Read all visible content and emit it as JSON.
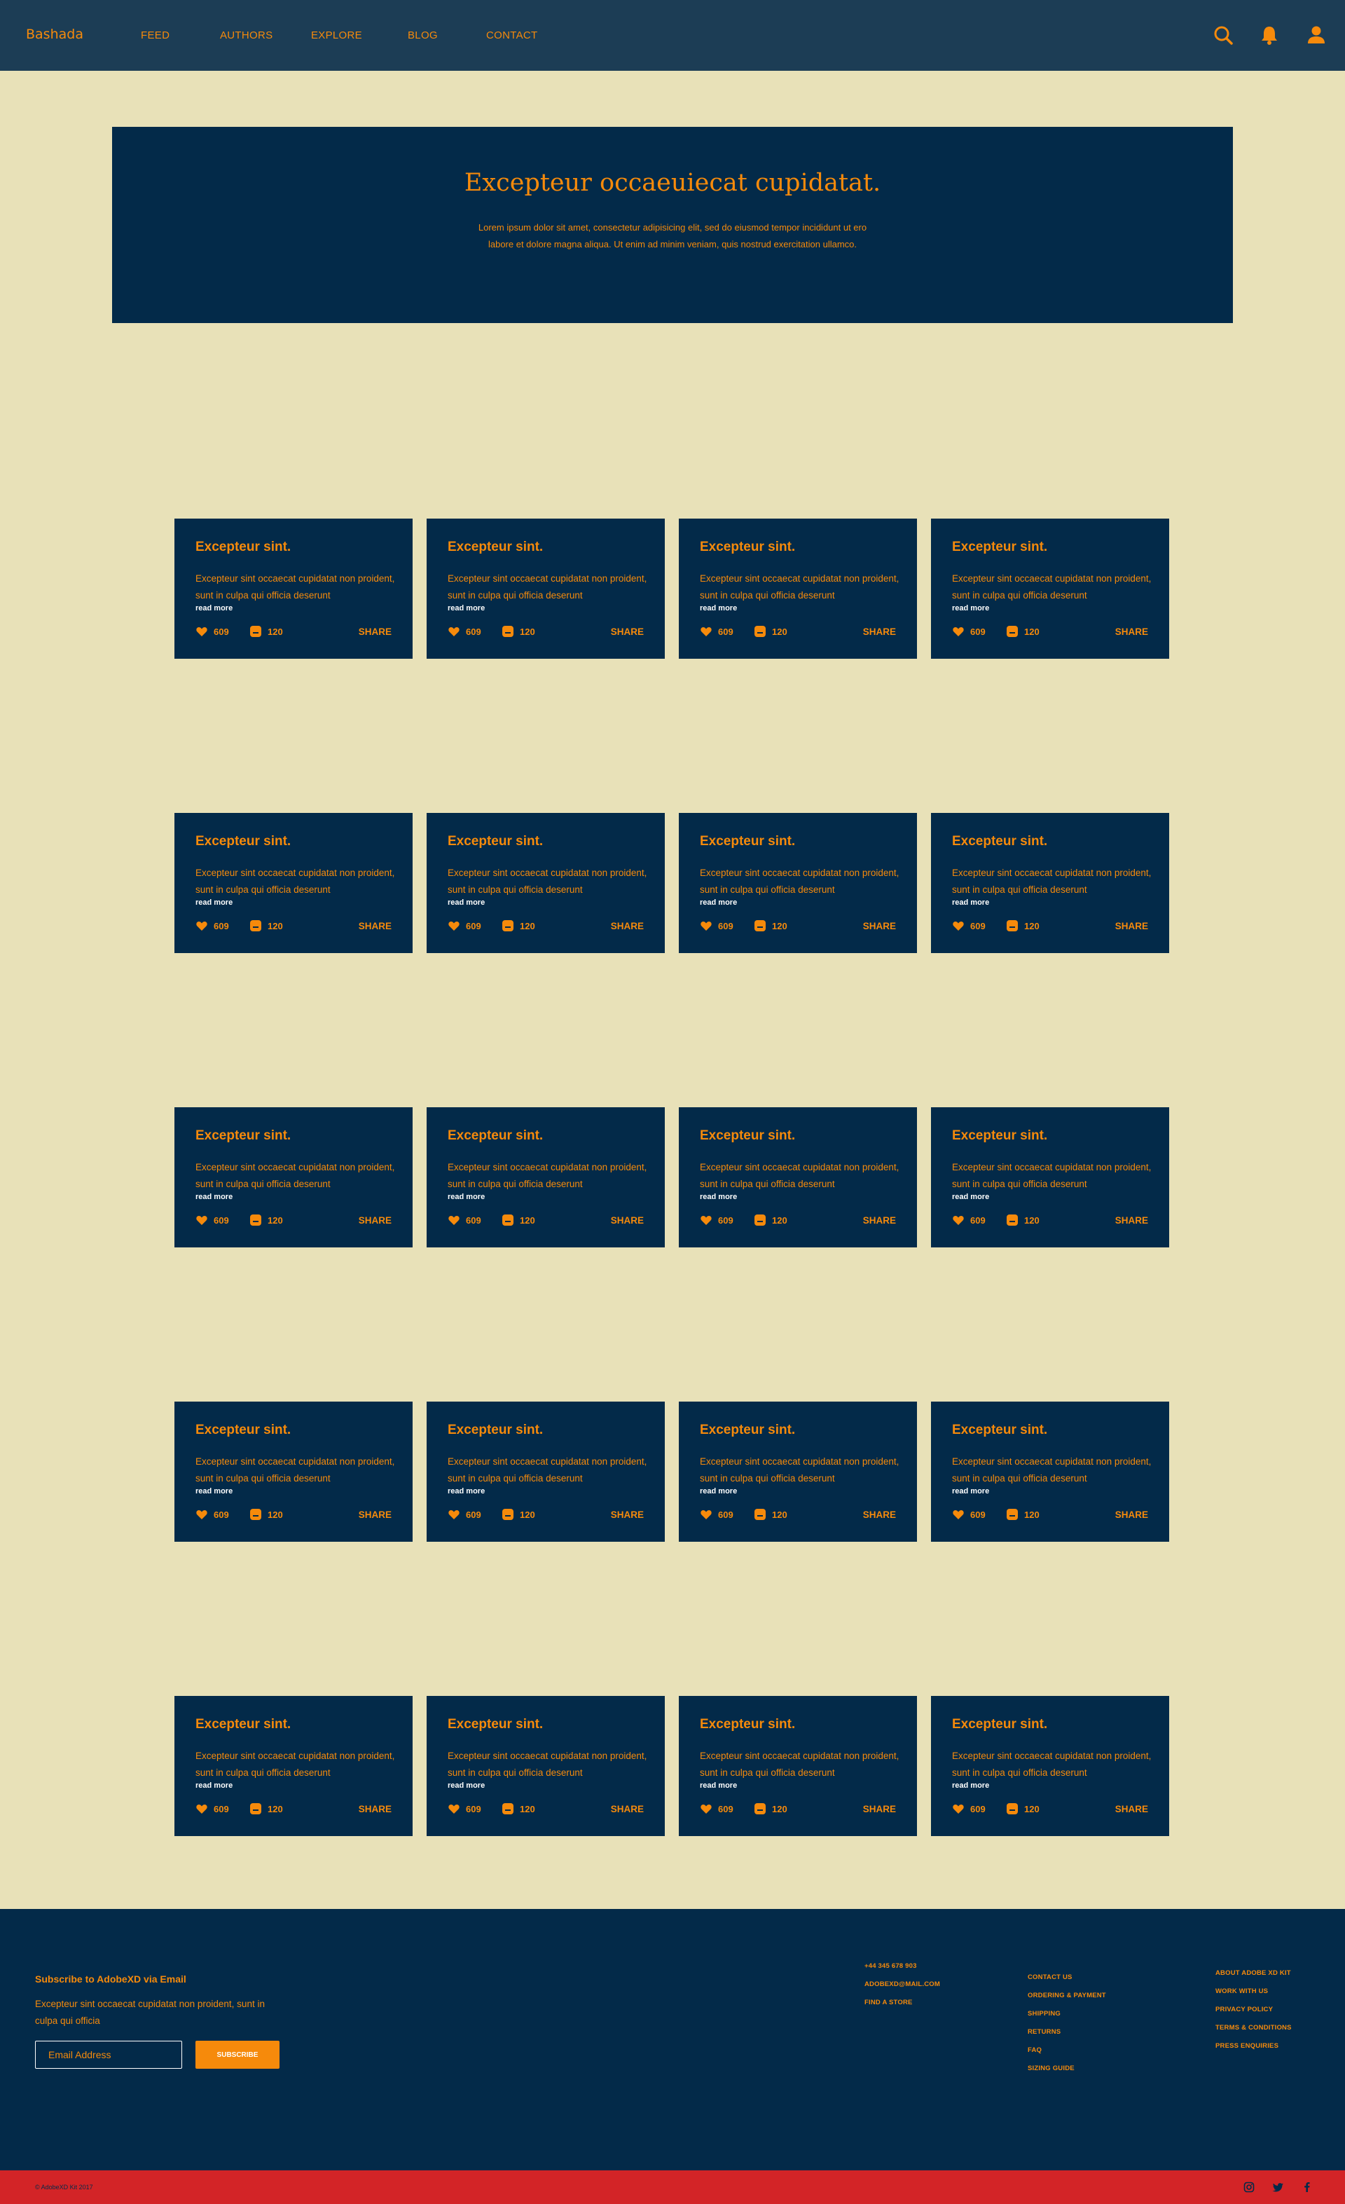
{
  "nav": {
    "brand": "Bashada",
    "links": [
      "FEED",
      "AUTHORS",
      "EXPLORE",
      "BLOG",
      "CONTACT"
    ],
    "icons": [
      "search-icon",
      "bell-icon",
      "user-icon"
    ]
  },
  "hero": {
    "title": "Excepteur occaeuiecat cupidatat.",
    "text": "Lorem ipsum dolor sit amet, consectetur adipisicing elit, sed do eiusmod tempor incididunt ut ero labore et dolore magna aliqua. Ut enim ad minim veniam, quis nostrud exercitation ullamco."
  },
  "card": {
    "title": "Excepteur sint.",
    "text": "Excepteur sint occaecat cupidatat non proident, sunt in culpa qui officia deserunt",
    "read_more": "read more",
    "likes": "609",
    "comments": "120",
    "share": "SHARE",
    "rows": 5,
    "columns": 4
  },
  "footer": {
    "subscribe_title": "Subscribe to AdobeXD via Email",
    "subscribe_text": "Excepteur sint occaecat cupidatat non proident, sunt in culpa qui officia",
    "email_placeholder": "Email Address",
    "subscribe_button": "SUBSCRIBE",
    "contact": [
      "+44 345 678 903",
      "ADOBEXD@MAIL.COM",
      "FIND A STORE"
    ],
    "help": [
      "CONTACT US",
      "ORDERING & PAYMENT",
      "SHIPPING",
      "RETURNS",
      "FAQ",
      "SIZING GUIDE"
    ],
    "about": [
      "ABOUT ADOBE XD KIT",
      "WORK WITH US",
      "PRIVACY POLICY",
      "TERMS & CONDITIONS",
      "PRESS ENQUIRIES"
    ]
  },
  "bottom": {
    "copyright": "© AdobeXD Kit 2017",
    "social": [
      "instagram-icon",
      "twitter-icon",
      "facebook-icon"
    ]
  },
  "colors": {
    "background": "#e8e1b8",
    "nav": "#1c3d55",
    "navy": "#032a49",
    "accent": "#f68a0b",
    "bottom_bar": "#d32427"
  }
}
